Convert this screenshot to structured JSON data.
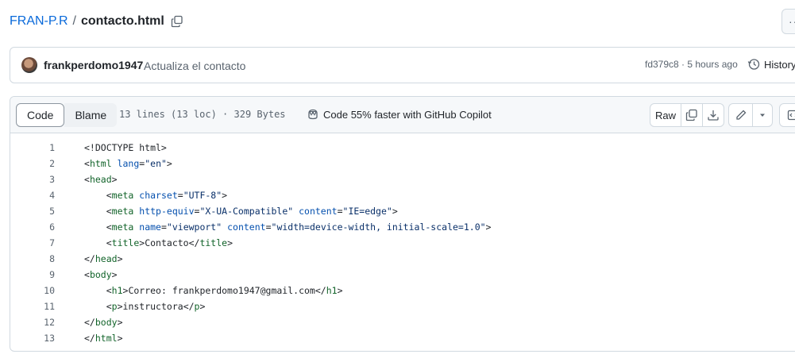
{
  "breadcrumb": {
    "repo": "FRAN-P.R",
    "separator": "/",
    "file": "contacto.html"
  },
  "more_button": {
    "label": "···"
  },
  "commit": {
    "author": "frankperdomo1947",
    "message": "Actualiza el contacto",
    "sha_time": "fd379c8 · 5 hours ago",
    "history_label": "History"
  },
  "file_header": {
    "tab_code": "Code",
    "tab_blame": "Blame",
    "info": "13 lines (13 loc) · 329 Bytes",
    "copilot": "Code 55% faster with GitHub Copilot",
    "raw_label": "Raw"
  },
  "code_lines": [
    "<!DOCTYPE html>",
    "<html lang=\"en\">",
    "<head>",
    "    <meta charset=\"UTF-8\">",
    "    <meta http-equiv=\"X-UA-Compatible\" content=\"IE=edge\">",
    "    <meta name=\"viewport\" content=\"width=device-width, initial-scale=1.0\">",
    "    <title>Contacto</title>",
    "</head>",
    "<body>",
    "    <h1>Correo: frankperdomo1947@gmail.com</h1>",
    "    <p>instructora</p>",
    "</body>",
    "</html>"
  ],
  "colors": {
    "link": "#0969da",
    "tag": "#116329",
    "attr": "#0550ae",
    "string": "#0a3069",
    "muted": "#59636e",
    "border": "#d1d9e0"
  }
}
